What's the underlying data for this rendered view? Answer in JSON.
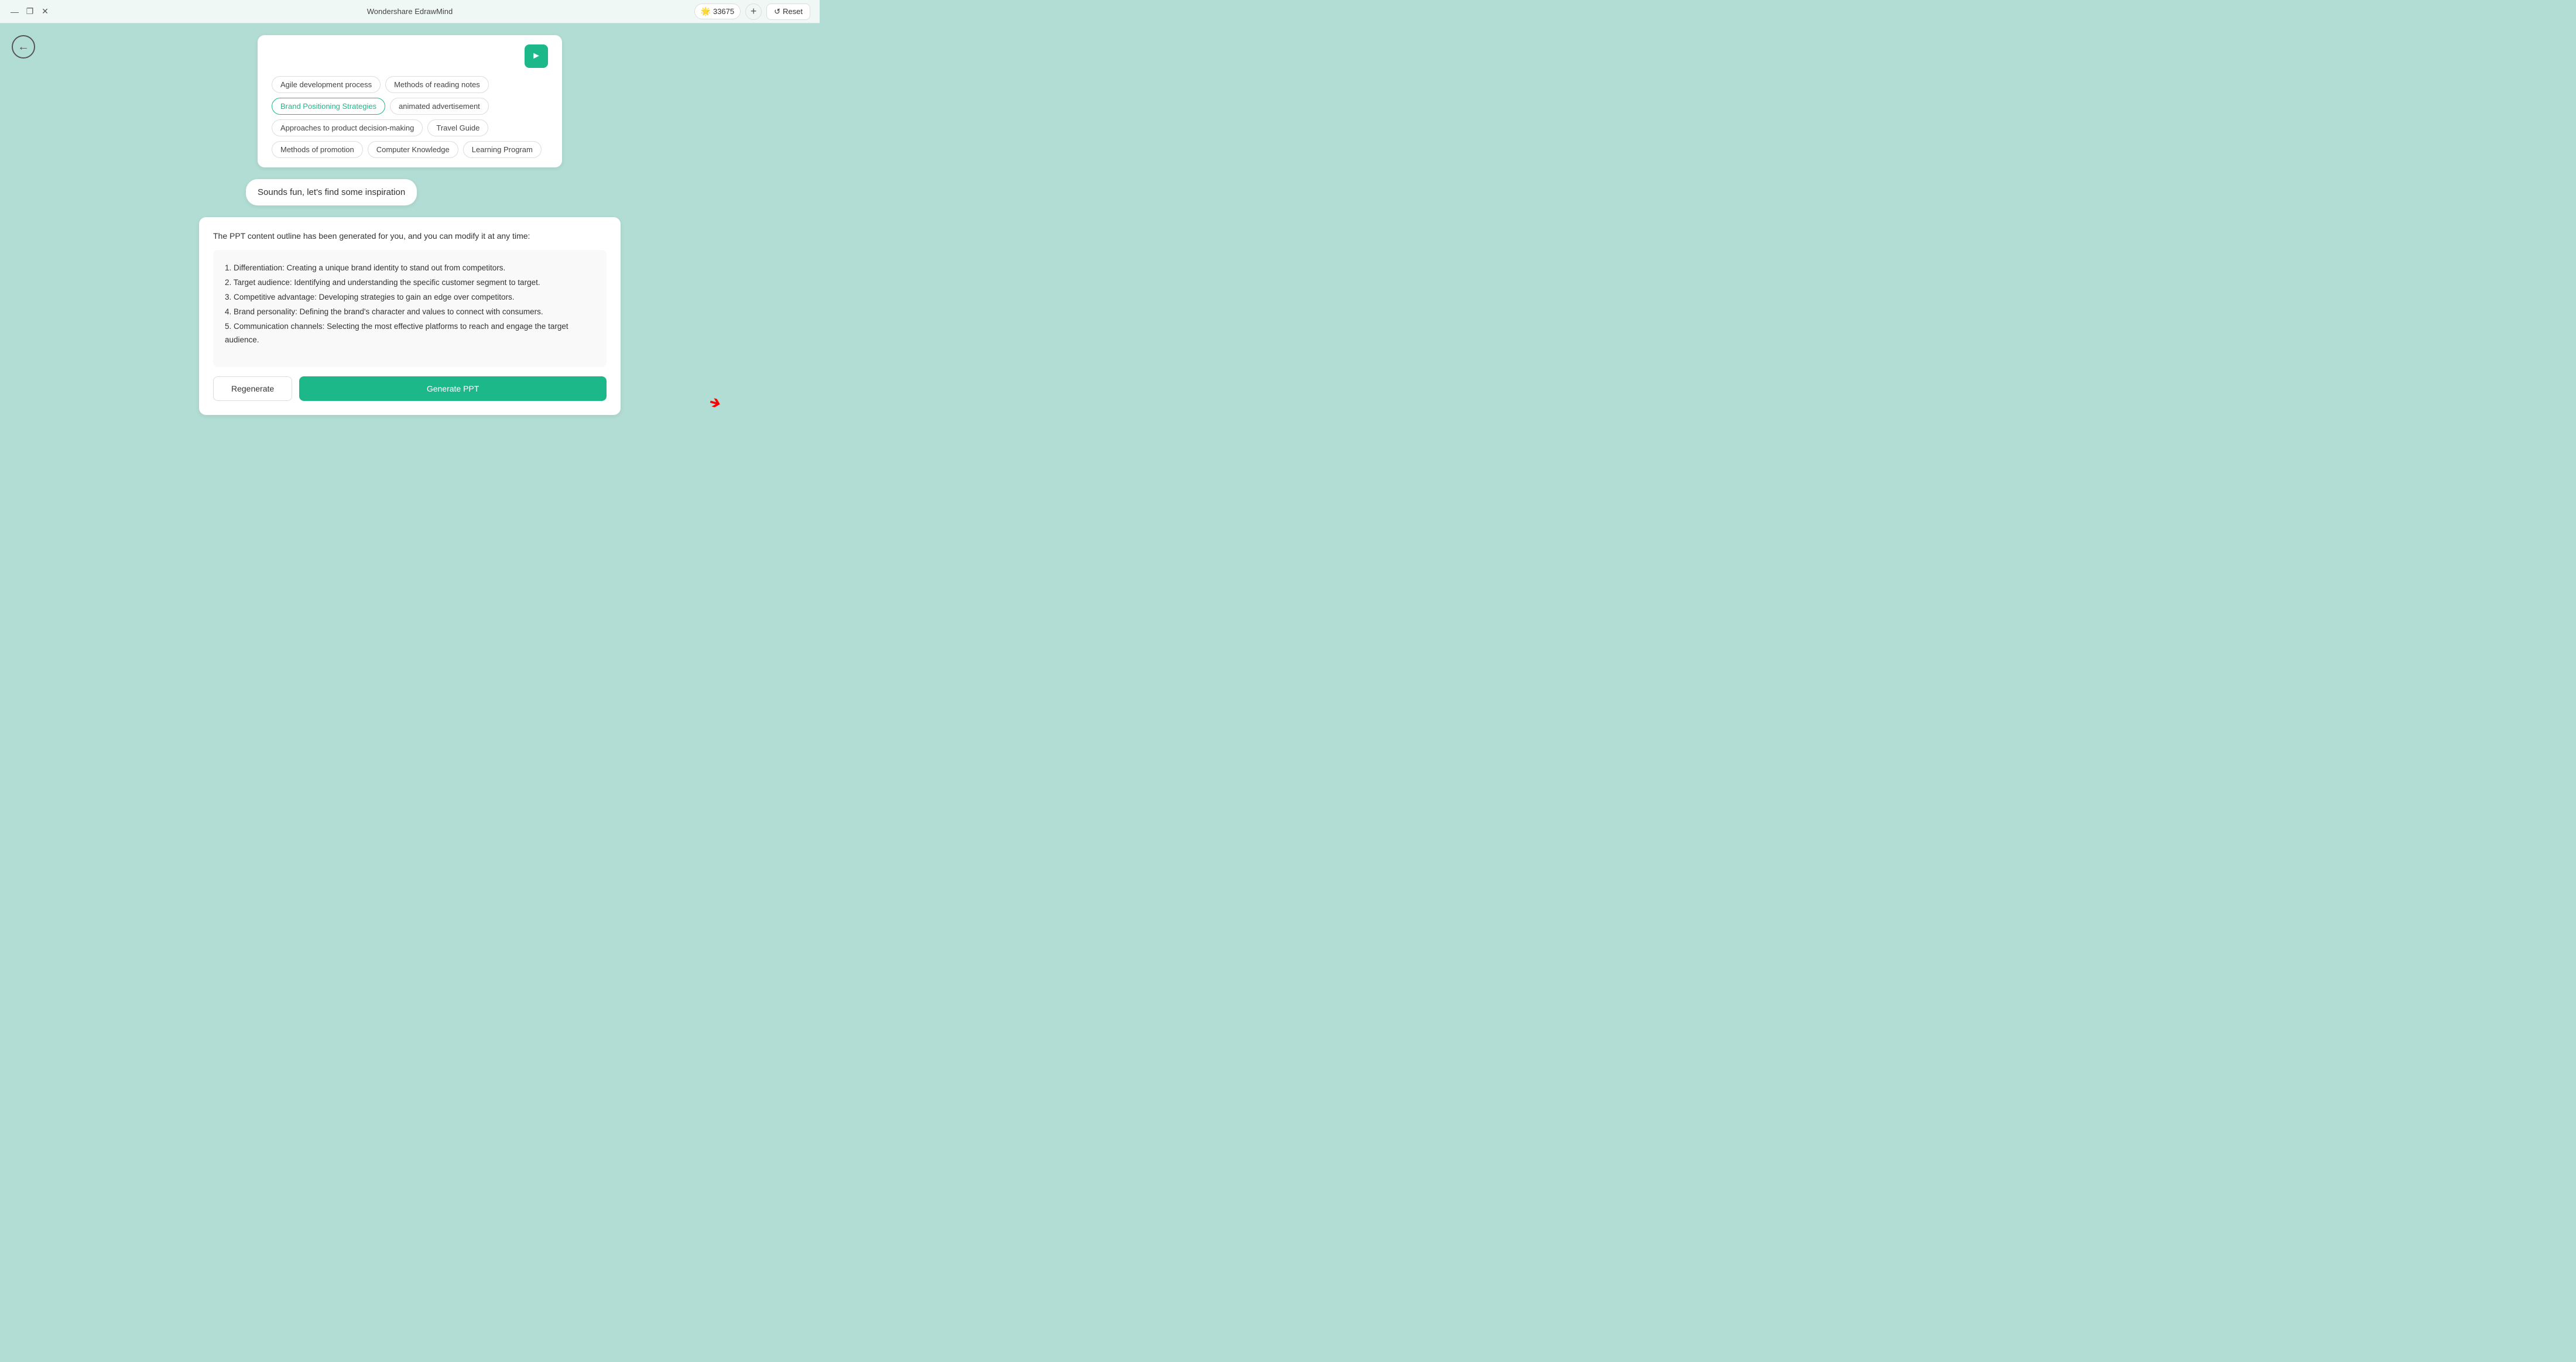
{
  "app": {
    "title": "Wondershare EdrawMind"
  },
  "window_controls": {
    "minimize": "—",
    "maximize": "❐",
    "close": "✕"
  },
  "points": {
    "icon": "🌟",
    "value": "33675",
    "add_label": "+"
  },
  "reset_btn": {
    "icon": "↺",
    "label": "Reset"
  },
  "topic_input": {
    "placeholder": ""
  },
  "chips": [
    {
      "label": "Agile development process",
      "active": false
    },
    {
      "label": "Methods of reading notes",
      "active": false
    },
    {
      "label": "Brand Positioning Strategies",
      "active": true
    },
    {
      "label": "animated advertisement",
      "active": false
    },
    {
      "label": "Approaches to product decision-making",
      "active": false
    },
    {
      "label": "Travel Guide",
      "active": false
    },
    {
      "label": "Methods of promotion",
      "active": false
    },
    {
      "label": "Computer Knowledge",
      "active": false
    },
    {
      "label": "Learning Program",
      "active": false
    }
  ],
  "fun_bubble": {
    "text": "Sounds fun, let's find some inspiration"
  },
  "generated": {
    "header": "The PPT content outline has been generated for you, and you can modify it at any time:",
    "items": [
      "1. Differentiation: Creating a unique brand identity to stand out from competitors.",
      "2. Target audience: Identifying and understanding the specific customer segment to target.",
      "3. Competitive advantage: Developing strategies to gain an edge over competitors.",
      "4. Brand personality: Defining the brand's character and values to connect with consumers.",
      "5. Communication channels: Selecting the most effective platforms to reach and engage the target audience."
    ]
  },
  "actions": {
    "regenerate": "Regenerate",
    "generate_ppt": "Generate PPT"
  }
}
